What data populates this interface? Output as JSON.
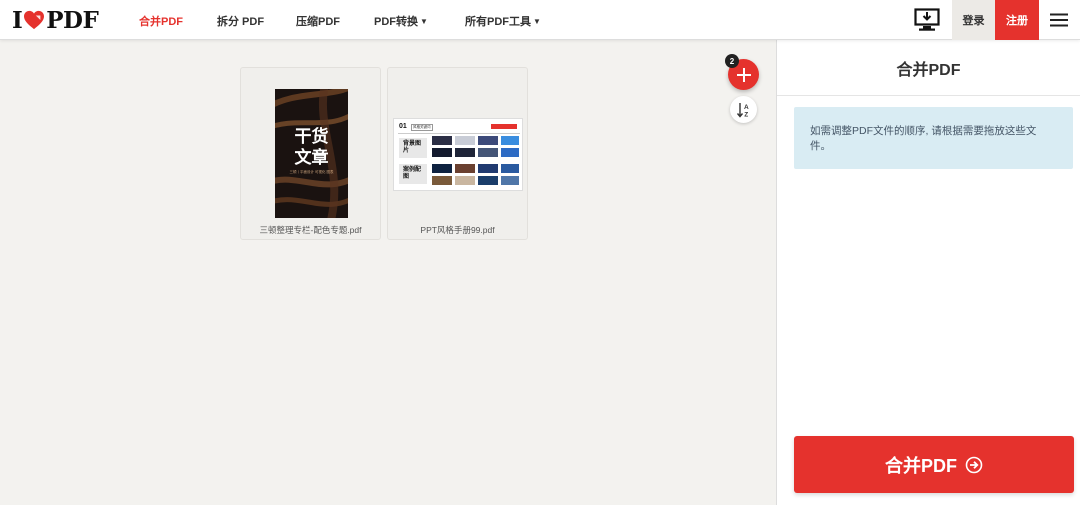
{
  "nav": {
    "logo_left": "I",
    "logo_right": "PDF",
    "items": [
      {
        "label": "合并PDF",
        "active": true
      },
      {
        "label": "拆分 PDF"
      },
      {
        "label": "压缩PDF"
      },
      {
        "label": "PDF转换",
        "dropdown": true
      },
      {
        "label": "所有PDF工具",
        "dropdown": true
      }
    ],
    "login": "登录",
    "signup": "注册"
  },
  "files": [
    {
      "name": "三顿整理专栏-配色专题.pdf",
      "thumb_title_1": "干货",
      "thumb_title_2": "文章",
      "thumb_sub": "三顿丨平面设计  可视化  图表"
    },
    {
      "name": "PPT风格手册99.pdf",
      "thumb_header": "01",
      "thumb_header_tag": "风格关键词",
      "thumb_row1": "背景图片",
      "thumb_row2": "案例配图"
    }
  ],
  "actions": {
    "file_count": "2"
  },
  "sidebar": {
    "title": "合并PDF",
    "info": "如需调整PDF文件的顺序, 请根据需要拖放这些文件。",
    "merge_button": "合并PDF"
  },
  "colors": {
    "brand_red": "#e5322d",
    "info_bg": "#d9ecf3",
    "canvas_bg": "#f3f2ef"
  }
}
